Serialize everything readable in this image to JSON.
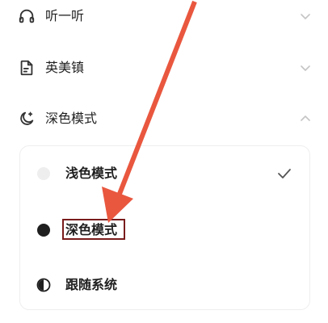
{
  "menu": {
    "items": [
      {
        "label": "听一听",
        "icon": "headphones-icon",
        "expanded": false
      },
      {
        "label": "英美镇",
        "icon": "document-icon",
        "expanded": false
      },
      {
        "label": "深色模式",
        "icon": "moon-icon",
        "expanded": true
      }
    ]
  },
  "theme_options": [
    {
      "label": "浅色模式",
      "icon": "light-circle-icon",
      "selected": true
    },
    {
      "label": "深色模式",
      "icon": "dark-circle-icon",
      "selected": false
    },
    {
      "label": "跟随系统",
      "icon": "half-circle-icon",
      "selected": false
    }
  ],
  "colors": {
    "annotation_arrow": "#e9573f",
    "highlight_box": "#7a1c1c",
    "text": "#1f1f1f",
    "chevron": "#c4c4c4",
    "check": "#555555"
  }
}
